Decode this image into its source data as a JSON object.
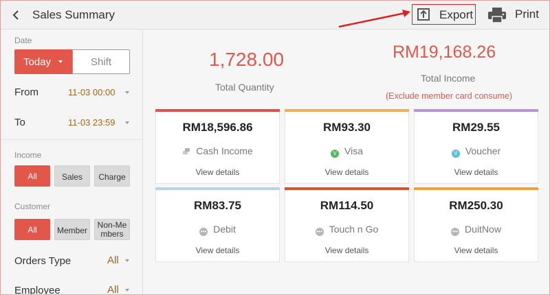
{
  "header": {
    "title": "Sales Summary",
    "export_label": "Export",
    "print_label": "Print"
  },
  "sidebar": {
    "date_label": "Date",
    "date_tabs": [
      "Today",
      "Shift"
    ],
    "from_label": "From",
    "from_value": "11-03 00:00",
    "to_label": "To",
    "to_value": "11-03 23:59",
    "income_label": "Income",
    "income_chips": [
      "All",
      "Sales",
      "Charge"
    ],
    "customer_label": "Customer",
    "customer_chips": [
      "All",
      "Member",
      "Non-Me",
      "mbers"
    ],
    "orders_type_label": "Orders Type",
    "orders_type_value": "All",
    "employee_label": "Employee",
    "employee_value": "All"
  },
  "summary": {
    "total_quantity": "1,728.00",
    "total_quantity_label": "Total Quantity",
    "total_income": "RM19,168.26",
    "total_income_label": "Total Income",
    "income_note": "(Exclude member card consume)"
  },
  "cards": [
    {
      "amount": "RM18,596.86",
      "method": "Cash Income",
      "icon": "cash-icon",
      "color": "#d9534f",
      "details": "View details"
    },
    {
      "amount": "RM93.30",
      "method": "Visa",
      "icon": "visa-icon",
      "color": "#f0ad5e",
      "details": "View details"
    },
    {
      "amount": "RM29.55",
      "method": "Voucher",
      "icon": "voucher-icon",
      "color": "#b892d4",
      "details": "View details"
    },
    {
      "amount": "RM83.75",
      "method": "Debit",
      "icon": "debit-icon",
      "color": "#b7d3e6",
      "details": "View details"
    },
    {
      "amount": "RM114.50",
      "method": "Touch n Go",
      "icon": "touchngo-icon",
      "color": "#d4552d",
      "details": "View details"
    },
    {
      "amount": "RM250.30",
      "method": "DuitNow",
      "icon": "duitnow-icon",
      "color": "#efa23a",
      "details": "View details"
    }
  ],
  "colors": {
    "accent": "#e3574b",
    "annotation_red": "#e02020"
  }
}
